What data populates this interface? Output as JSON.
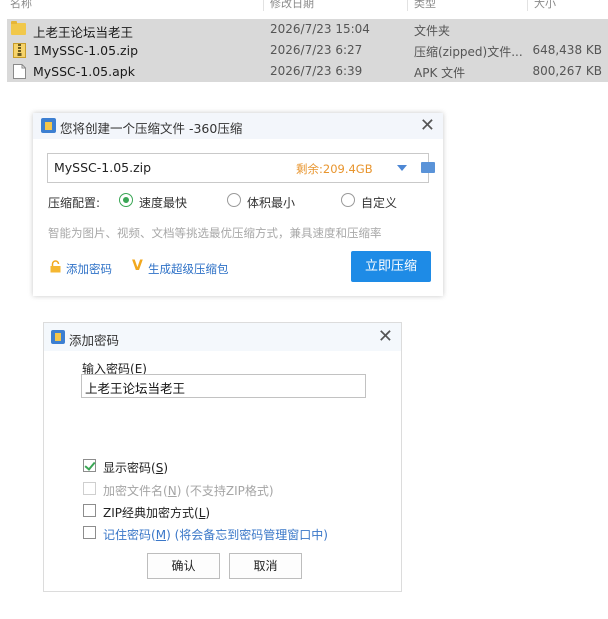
{
  "file_list": {
    "columns": [
      "名称",
      "修改日期",
      "类型",
      "大小"
    ],
    "rows": [
      {
        "name": "上老王论坛当老王",
        "date": "2026/7/23 15:04",
        "type": "文件夹",
        "size": "",
        "icon": "folder-icon"
      },
      {
        "name": "1MySSC-1.05.zip",
        "date": "2026/7/23 6:27",
        "type": "压缩(zipped)文件...",
        "size": "648,438 KB",
        "icon": "zip-file-icon"
      },
      {
        "name": "MySSC-1.05.apk",
        "date": "2026/7/23 6:39",
        "type": "APK 文件",
        "size": "800,267 KB",
        "icon": "file-icon"
      }
    ]
  },
  "compress_dialog": {
    "title": "您将创建一个压缩文件 -360压缩",
    "filename": "MySSC-1.05.zip",
    "remaining": "剩余:209.4GB",
    "config_label": "压缩配置:",
    "options": [
      "速度最快",
      "体积最小",
      "自定义"
    ],
    "selected_option": "速度最快",
    "hint": "智能为图片、视频、文档等挑选最优压缩方式，兼具速度和压缩率",
    "add_password": "添加密码",
    "super_compress": "生成超级压缩包",
    "compress_button": "立即压缩",
    "accent_color": "#1e8be6"
  },
  "password_dialog": {
    "title": "添加密码",
    "input_label": "输入密码",
    "input_label_key": "E",
    "password_value": "上老王论坛当老王",
    "checkboxes": [
      {
        "label": "显示密码",
        "key": "S",
        "suffix": "",
        "checked": true,
        "disabled": false
      },
      {
        "label": "加密文件名",
        "key": "N",
        "suffix": " (不支持ZIP格式)",
        "checked": false,
        "disabled": true
      },
      {
        "label": "ZIP经典加密方式",
        "key": "L",
        "suffix": "",
        "checked": false,
        "disabled": false
      },
      {
        "label": "记住密码",
        "key": "M",
        "suffix": " (将会备忘到密码管理窗口中)",
        "checked": false,
        "disabled": false
      }
    ],
    "ok_button": "确认",
    "cancel_button": "取消"
  }
}
